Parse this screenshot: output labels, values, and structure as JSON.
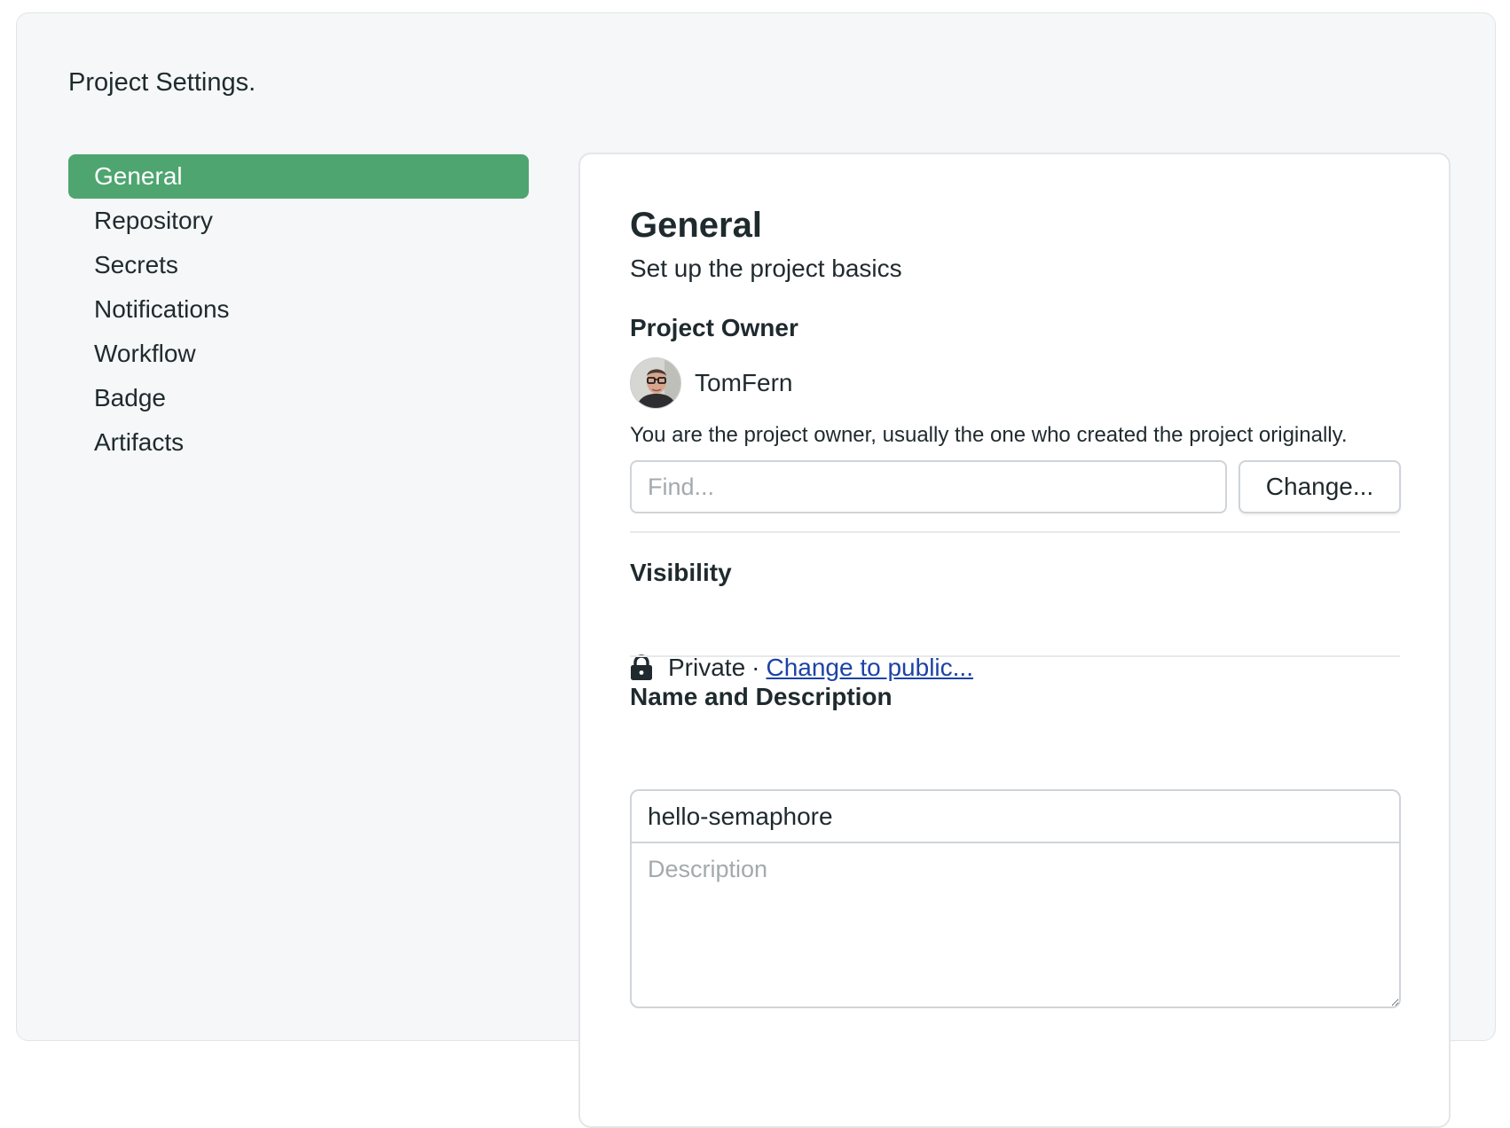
{
  "page": {
    "title": "Project Settings."
  },
  "sidebar": {
    "items": [
      {
        "label": "General",
        "active": true
      },
      {
        "label": "Repository",
        "active": false
      },
      {
        "label": "Secrets",
        "active": false
      },
      {
        "label": "Notifications",
        "active": false
      },
      {
        "label": "Workflow",
        "active": false
      },
      {
        "label": "Badge",
        "active": false
      },
      {
        "label": "Artifacts",
        "active": false
      }
    ]
  },
  "general": {
    "heading": "General",
    "subtitle": "Set up the project basics"
  },
  "owner": {
    "section_title": "Project Owner",
    "name": "TomFern",
    "avatar_icon": "user-avatar",
    "note": "You are the project owner, usually the one who created the project originally.",
    "find_placeholder": "Find...",
    "change_label": "Change..."
  },
  "visibility": {
    "section_title": "Visibility",
    "icon": "lock-icon",
    "status": "Private",
    "separator": "·",
    "change_link": "Change to public..."
  },
  "name_description": {
    "section_title": "Name and Description",
    "name_value": "hello-semaphore",
    "description_placeholder": "Description"
  },
  "colors": {
    "accent": "#4ea56f",
    "link": "#1c43a6",
    "text": "#1f2a2e",
    "background": "#f5f7f8"
  }
}
